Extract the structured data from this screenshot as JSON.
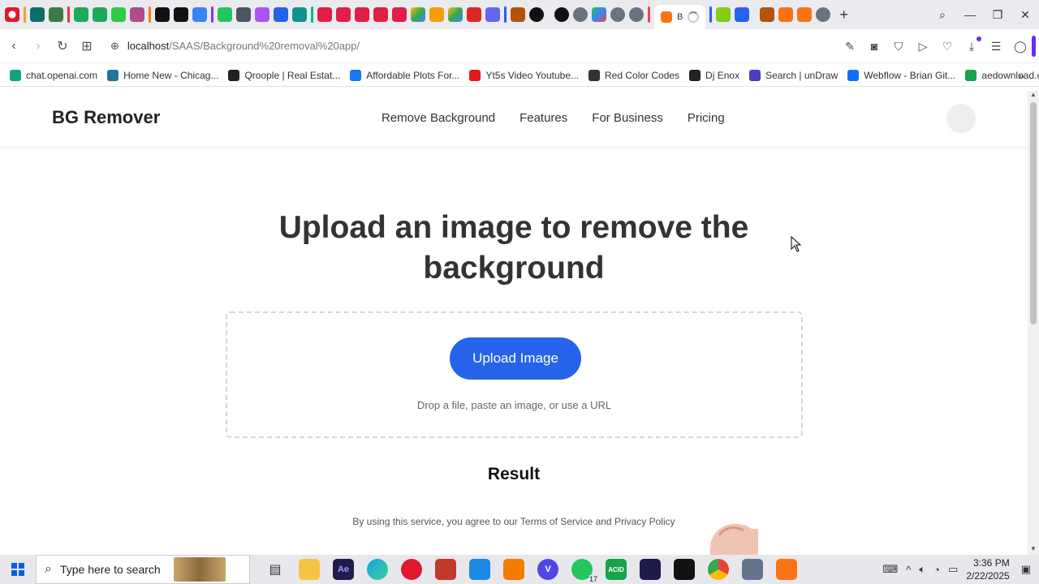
{
  "browser": {
    "active_tab": {
      "label": "B"
    },
    "url": {
      "host": "localhost",
      "path": "/SAAS/Background%20removal%20app/"
    },
    "bookmarks": [
      {
        "label": "chat.openai.com",
        "color": "#10a37f"
      },
      {
        "label": "Home New - Chicag...",
        "color": "#21759b"
      },
      {
        "label": "Qroople | Real Estat...",
        "color": "#222222"
      },
      {
        "label": "Affordable Plots For...",
        "color": "#1877f2"
      },
      {
        "label": "Yt5s Video Youtube...",
        "color": "#e01b1b"
      },
      {
        "label": "Red Color Codes",
        "color": "#333333"
      },
      {
        "label": "Dj Enox",
        "color": "#222222"
      },
      {
        "label": "Search | unDraw",
        "color": "#4b3cc9"
      },
      {
        "label": "Webflow - Brian Git...",
        "color": "#146ef5"
      },
      {
        "label": "aedownload.com",
        "color": "#16a34a"
      }
    ],
    "bookmarks_more": "»"
  },
  "site": {
    "logo": "BG Remover",
    "nav": [
      "Remove Background",
      "Features",
      "For Business",
      "Pricing"
    ],
    "hero_title": "Upload an image to remove the background",
    "upload_button": "Upload Image",
    "drop_hint": "Drop a file, paste an image, or use a URL",
    "result_heading": "Result",
    "terms": "By using this service, you agree to our Terms of Service and Privacy Policy",
    "accent_color": "#2563eb"
  },
  "taskbar": {
    "search_placeholder": "Type here to search",
    "whatsapp_count": "17",
    "time": "3:36 PM",
    "date": "2/22/2025"
  }
}
